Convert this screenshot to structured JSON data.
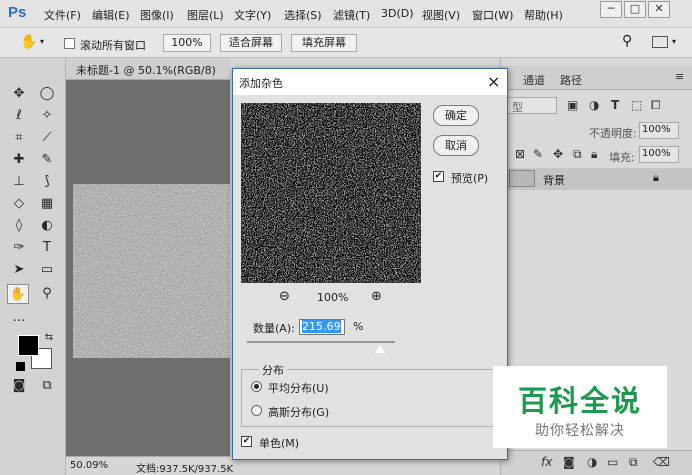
{
  "menubar": {
    "logo": "Ps",
    "items": [
      "文件(F)",
      "编辑(E)",
      "图像(I)",
      "图层(L)",
      "文字(Y)",
      "选择(S)",
      "滤镜(T)",
      "3D(D)",
      "视图(V)",
      "窗口(W)",
      "帮助(H)"
    ],
    "window_buttons": {
      "minimize": "─",
      "restore": "□",
      "close": "✕"
    }
  },
  "options_bar": {
    "scroll_all_label": "滚动所有窗口",
    "zoom_value": "100%",
    "fit_screen_label": "适合屏幕",
    "fill_screen_label": "填充屏幕"
  },
  "document": {
    "tab_title": "未标题-1 @ 50.1%(RGB/8)",
    "tab_close": "×",
    "zoom_status": "50.09%",
    "doc_info": "文档:937.5K/937.5K"
  },
  "layers_panel": {
    "tabs": [
      "通道",
      "路径"
    ],
    "kind_label": "型",
    "opacity_label": "不透明度:",
    "opacity_value": "100%",
    "fill_label": "填充:",
    "fill_value": "100%",
    "layer_name": "背景"
  },
  "dialog": {
    "title": "添加杂色",
    "close": "×",
    "ok_label": "确定",
    "cancel_label": "取消",
    "preview_label": "预览(P)",
    "zoom_value": "100%",
    "amount_label": "数量(A):",
    "amount_value": "215.69",
    "amount_unit": "%",
    "distribution_legend": "分布",
    "uniform_label": "平均分布(U)",
    "gaussian_label": "高斯分布(G)",
    "mono_label": "单色(M)",
    "preview_checked": true,
    "mono_checked": true,
    "distribution_selected": "uniform",
    "amount_slider_fraction": 0.9
  },
  "watermark": {
    "title": "百科全说",
    "subtitle": "助你轻松解决"
  },
  "colors": {
    "foreground": "#000000",
    "background": "#ffffff",
    "logo_blue": "#2b6fb6",
    "watermark_green": "#1e9a50"
  }
}
